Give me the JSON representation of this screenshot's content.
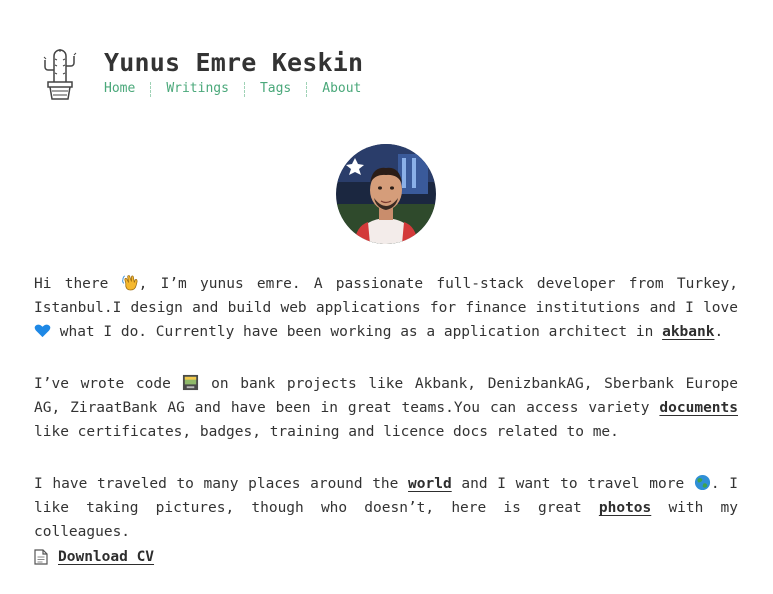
{
  "site": {
    "title": "Yunus Emre Keskin",
    "nav": [
      "Home",
      "Writings",
      "Tags",
      "About"
    ]
  },
  "bio": {
    "p1": {
      "t1": "Hi there ",
      "t2": ", I’m yunus emre. A passionate full-stack developer from Turkey, Istanbul.I design and build web applications for finance institutions and I love ",
      "t3": " what I do. Currently have been working as a application architect in ",
      "link": "akbank",
      "t4": "."
    },
    "p2": {
      "t1": "I’ve wrote code ",
      "t2": " on bank projects like Akbank, DenizbankAG, Sberbank Europe AG, ZiraatBank AG and have been in great teams.You can access variety ",
      "link": "documents",
      "t3": " like certificates, badges, training and licence docs related to me."
    },
    "p3": {
      "t1": "I have traveled to many places around the ",
      "link1": "world",
      "t2": " and I want to travel more ",
      "t3": ". I like taking pictures, though who doesn’t, here is great ",
      "link2": "photos",
      "t4": " with my colleagues."
    }
  },
  "download": {
    "label": "Download CV"
  },
  "icons": {
    "logo": "cactus-pot-icon",
    "wave": "waving-hand-icon",
    "heart": "blue-heart-icon",
    "code": "computer-screen-icon",
    "globe": "globe-icon",
    "document": "document-icon"
  },
  "colors": {
    "nav_link": "#4aa87a",
    "text": "#333333",
    "heart": "#1e88e5"
  }
}
